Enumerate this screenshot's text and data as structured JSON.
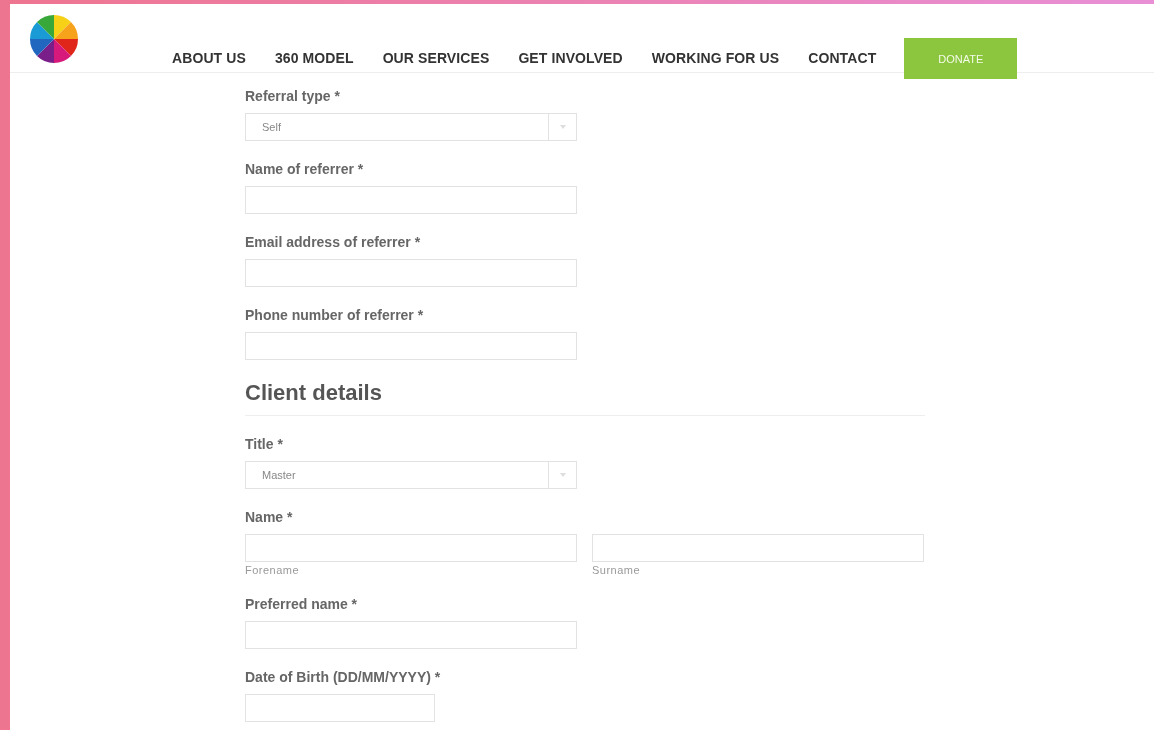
{
  "nav": {
    "items": [
      {
        "label": "ABOUT US"
      },
      {
        "label": "360 MODEL"
      },
      {
        "label": "OUR SERVICES"
      },
      {
        "label": "GET INVOLVED"
      },
      {
        "label": "WORKING FOR US"
      },
      {
        "label": "CONTACT"
      }
    ],
    "button": "DONATE"
  },
  "form": [
    {
      "kind": "select",
      "label": "Referral type *",
      "value": "Self"
    },
    {
      "kind": "text",
      "label": "Name of referrer *"
    },
    {
      "kind": "text",
      "label": "Email address of referrer *"
    },
    {
      "kind": "text",
      "label": "Phone number of referrer *"
    },
    {
      "kind": "heading",
      "label": "Client details"
    },
    {
      "kind": "select",
      "label": "Title *",
      "value": "Master"
    },
    {
      "kind": "pair",
      "label": "Name *",
      "sublabels": [
        "Forename",
        "Surname"
      ]
    },
    {
      "kind": "text",
      "label": "Preferred name *"
    },
    {
      "kind": "date",
      "label": "Date of Birth (DD/MM/YYYY) *"
    }
  ]
}
